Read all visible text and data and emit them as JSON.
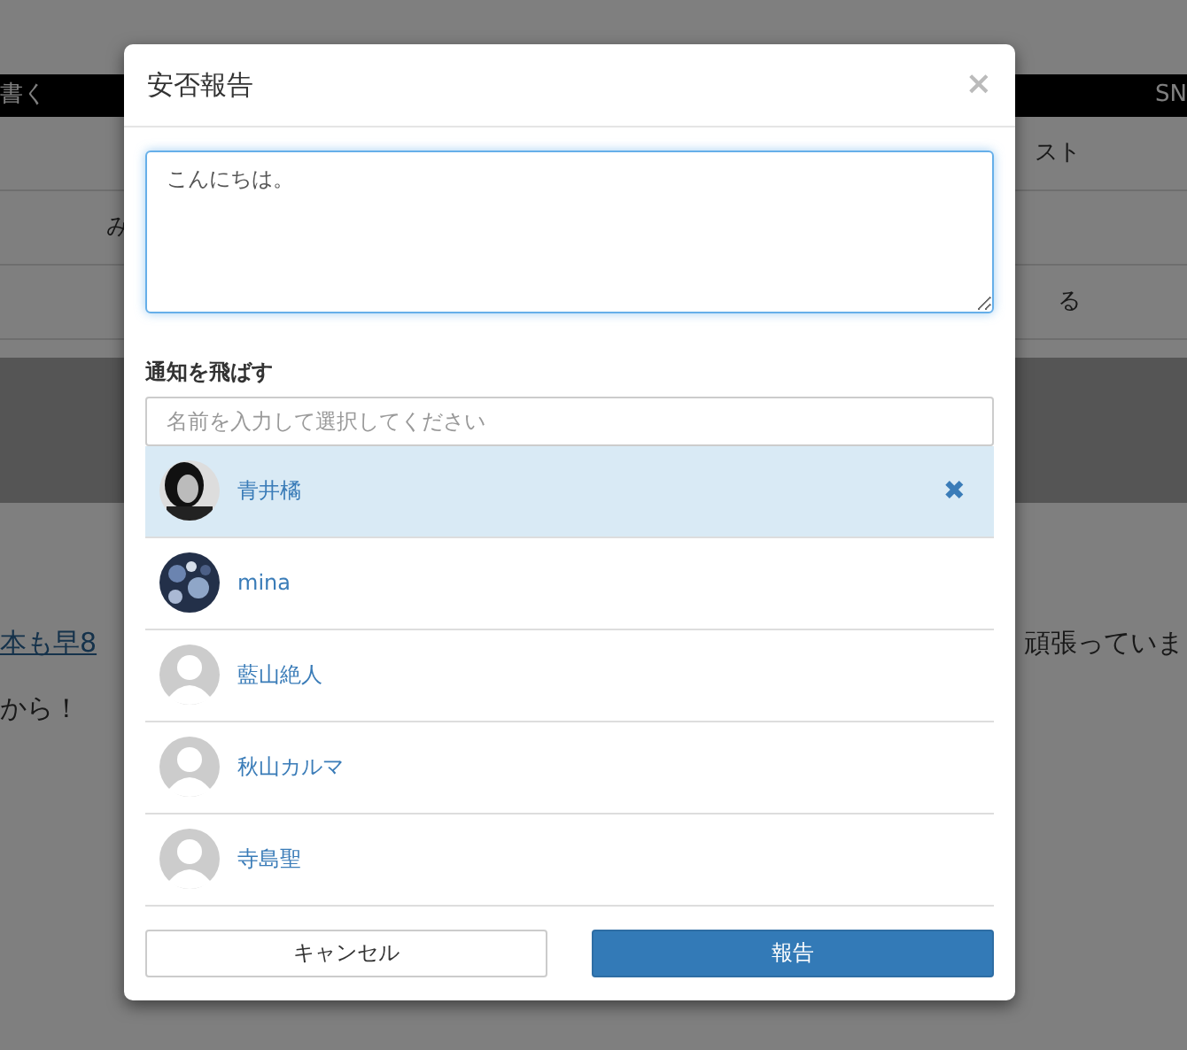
{
  "page": {
    "nav_left": "書く",
    "nav_right": "SN",
    "menu_rows": [
      {
        "left": "",
        "right": "スト"
      },
      {
        "left": "み",
        "right": ""
      },
      {
        "left": "",
        "right": "る"
      }
    ],
    "article": {
      "link": "本も早8",
      "text_right": "頑張っていま",
      "line2": "から！"
    }
  },
  "modal": {
    "title": "安否報告",
    "close": "×",
    "message": "こんにちは。",
    "notify_label": "通知を飛ばす",
    "search": {
      "placeholder": "名前を入力して選択してください"
    },
    "recipients": [
      {
        "name": "青井橘",
        "selected": true
      },
      {
        "name": "mina",
        "selected": false
      },
      {
        "name": "藍山絶人",
        "kind": "default",
        "selected": false
      },
      {
        "name": "秋山カルマ",
        "kind": "default",
        "selected": false
      },
      {
        "name": "寺島聖",
        "kind": "default",
        "selected": false
      }
    ],
    "remove": "✖",
    "buttons": [
      {
        "label": "キャンセル",
        "kind": "secondary"
      },
      {
        "label": "報告",
        "kind": "primary"
      }
    ]
  }
}
